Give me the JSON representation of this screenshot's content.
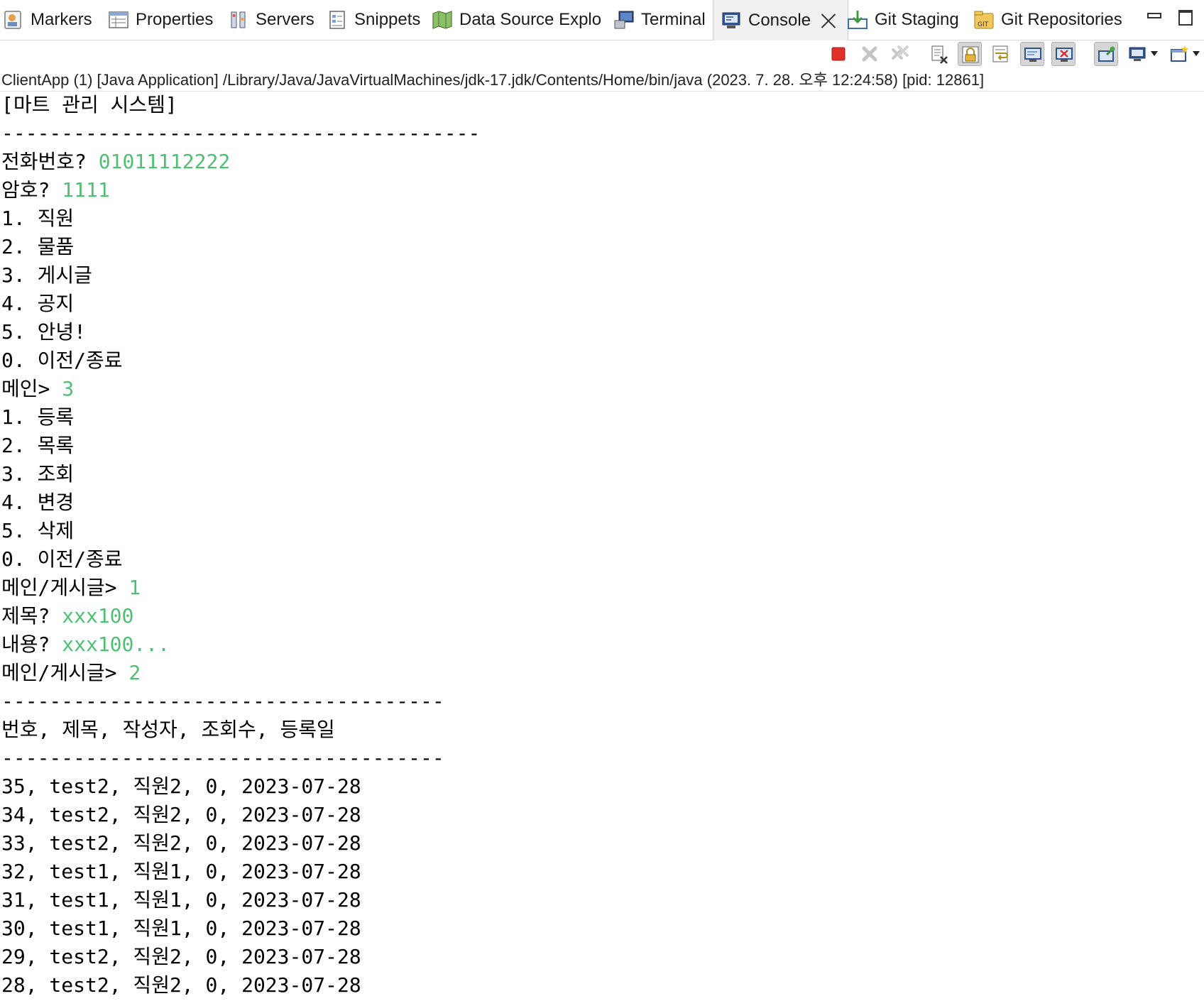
{
  "tabs": [
    {
      "label": "Markers",
      "icon": "markers-icon"
    },
    {
      "label": "Properties",
      "icon": "properties-icon"
    },
    {
      "label": "Servers",
      "icon": "servers-icon"
    },
    {
      "label": "Snippets",
      "icon": "snippets-icon"
    },
    {
      "label": "Data Source Explo",
      "icon": "data-source-icon"
    },
    {
      "label": "Terminal",
      "icon": "terminal-icon"
    },
    {
      "label": "Console",
      "icon": "console-icon",
      "active": true
    },
    {
      "label": "Git Staging",
      "icon": "git-staging-icon"
    },
    {
      "label": "Git Repositories",
      "icon": "git-repositories-icon"
    }
  ],
  "toolbar": {
    "buttons": [
      {
        "name": "terminate-icon"
      },
      {
        "name": "remove-launch-icon"
      },
      {
        "name": "remove-all-terminated-icon"
      },
      {
        "name": "clear-console-icon"
      },
      {
        "name": "scroll-lock-icon"
      },
      {
        "name": "word-wrap-icon"
      },
      {
        "name": "show-on-stdout-icon"
      },
      {
        "name": "show-on-stderr-icon"
      },
      {
        "name": "pin-console-icon"
      },
      {
        "name": "display-console-icon"
      },
      {
        "name": "open-console-icon"
      }
    ]
  },
  "process": {
    "description": "ClientApp (1) [Java Application] /Library/Java/JavaVirtualMachines/jdk-17.jdk/Contents/Home/bin/java  (2023. 7. 28. 오후 12:24:58) [pid: 12861]"
  },
  "console": {
    "colors": {
      "output": "#000000",
      "input": "#4fbf73"
    },
    "lines": [
      {
        "text": "[마트 관리 시스템]",
        "input": ""
      },
      {
        "text": "----------------------------------------",
        "input": ""
      },
      {
        "text": "전화번호? ",
        "input": "01011112222"
      },
      {
        "text": "암호? ",
        "input": "1111"
      },
      {
        "text": "1. 직원",
        "input": ""
      },
      {
        "text": "2. 물품",
        "input": ""
      },
      {
        "text": "3. 게시글",
        "input": ""
      },
      {
        "text": "4. 공지",
        "input": ""
      },
      {
        "text": "5. 안녕!",
        "input": ""
      },
      {
        "text": "0. 이전/종료",
        "input": ""
      },
      {
        "text": "메인> ",
        "input": "3"
      },
      {
        "text": "1. 등록",
        "input": ""
      },
      {
        "text": "2. 목록",
        "input": ""
      },
      {
        "text": "3. 조회",
        "input": ""
      },
      {
        "text": "4. 변경",
        "input": ""
      },
      {
        "text": "5. 삭제",
        "input": ""
      },
      {
        "text": "0. 이전/종료",
        "input": ""
      },
      {
        "text": "메인/게시글> ",
        "input": "1"
      },
      {
        "text": "제목? ",
        "input": "xxx100"
      },
      {
        "text": "내용? ",
        "input": "xxx100..."
      },
      {
        "text": "메인/게시글> ",
        "input": "2"
      },
      {
        "text": "-------------------------------------",
        "input": ""
      },
      {
        "text": "번호, 제목, 작성자, 조회수, 등록일",
        "input": ""
      },
      {
        "text": "-------------------------------------",
        "input": ""
      },
      {
        "text": "35, test2, 직원2, 0, 2023-07-28",
        "input": ""
      },
      {
        "text": "34, test2, 직원2, 0, 2023-07-28",
        "input": ""
      },
      {
        "text": "33, test2, 직원2, 0, 2023-07-28",
        "input": ""
      },
      {
        "text": "32, test1, 직원1, 0, 2023-07-28",
        "input": ""
      },
      {
        "text": "31, test1, 직원1, 0, 2023-07-28",
        "input": ""
      },
      {
        "text": "30, test1, 직원1, 0, 2023-07-28",
        "input": ""
      },
      {
        "text": "29, test2, 직원2, 0, 2023-07-28",
        "input": ""
      },
      {
        "text": "28, test2, 직원2, 0, 2023-07-28",
        "input": ""
      }
    ]
  }
}
